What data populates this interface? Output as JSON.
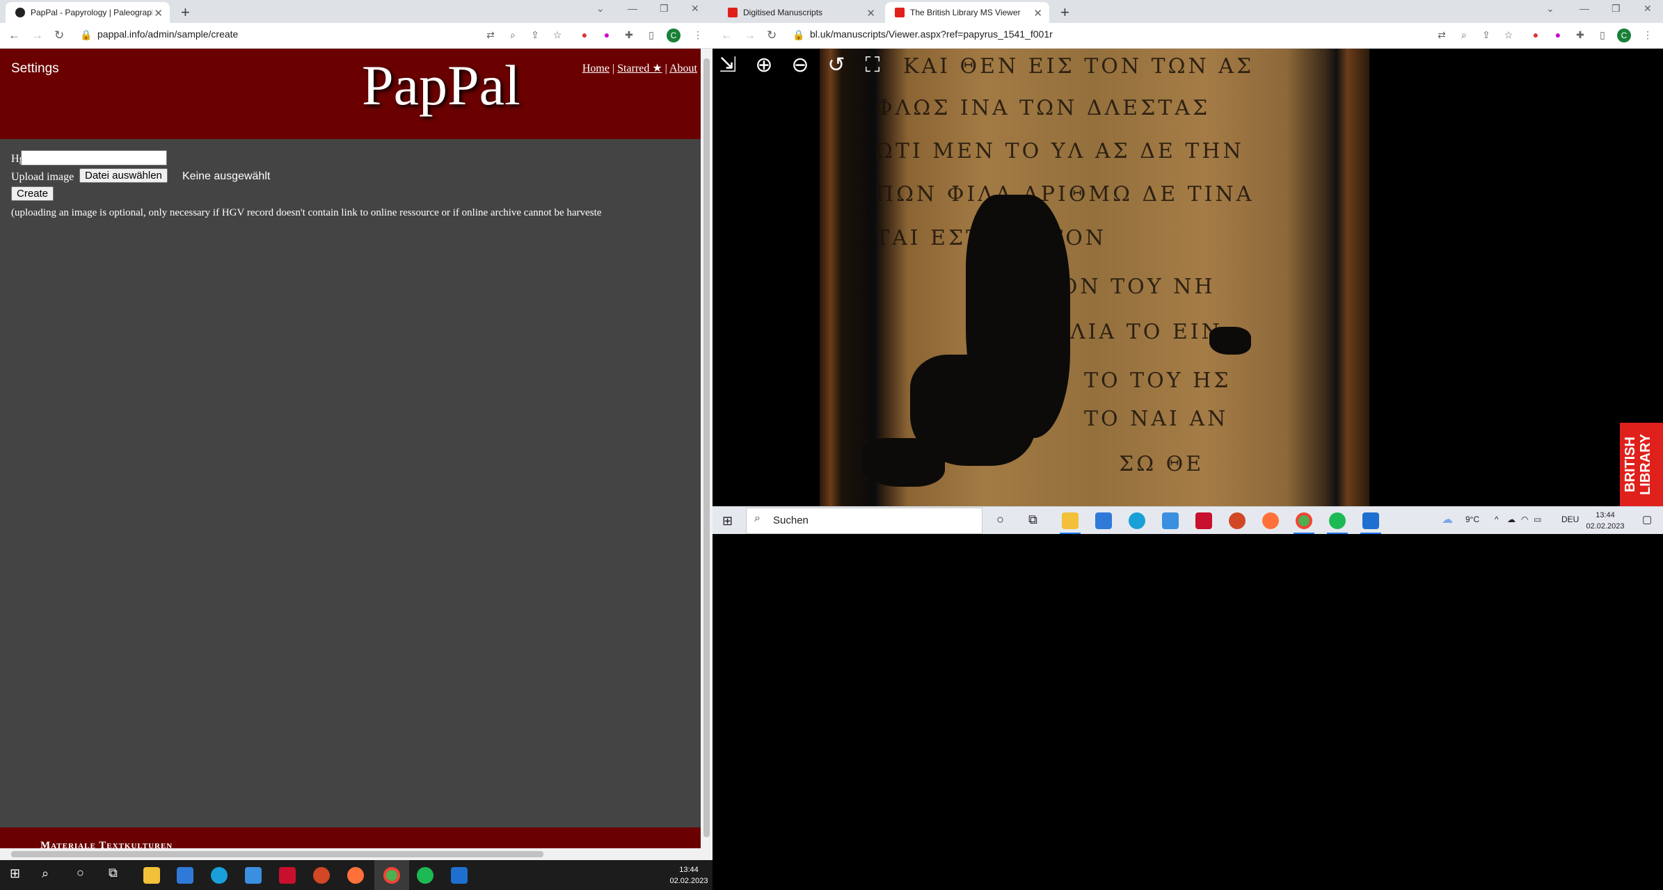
{
  "left_window": {
    "tab_title": "PapPal - Papyrology | Paleograph",
    "url": "pappal.info/admin/sample/create",
    "page": {
      "settings_label": "Settings",
      "logo": "PapPal",
      "nav": [
        "Home",
        "Starred ★",
        "About"
      ],
      "hgv_label": "Hgv",
      "upload_label": "Upload image",
      "file_button": "Datei auswählen",
      "file_status": "Keine ausgewählt",
      "create_button": "Create",
      "hint": "(uploading an image is optional, only necessary if HGV record doesn't contain link to online ressource or if online archive cannot be harveste",
      "footer": "Materiale Textkulturen"
    },
    "avatar_letter": "C"
  },
  "right_window": {
    "tabs": [
      "Digitised Manuscripts",
      "The British Library MS Viewer"
    ],
    "url": "bl.uk/manuscripts/Viewer.aspx?ref=papyrus_1541_f001r",
    "avatar_letter": "C",
    "viewer_tools": [
      "exit-icon",
      "zoom-in-icon",
      "zoom-out-icon",
      "rotate-icon",
      "fit-icon"
    ],
    "bl_logo": "BRITISH LIBRARY",
    "taskbar": {
      "search_placeholder": "Suchen",
      "weather": "9°C",
      "lang": "DEU",
      "time": "13:44",
      "date": "02.02.2023"
    }
  },
  "left_taskbar": {
    "time": "13:44",
    "date": "02.02.2023"
  },
  "colors": {
    "header_red": "#6a0000",
    "page_bg": "#444444",
    "bl_red": "#e0201b"
  }
}
